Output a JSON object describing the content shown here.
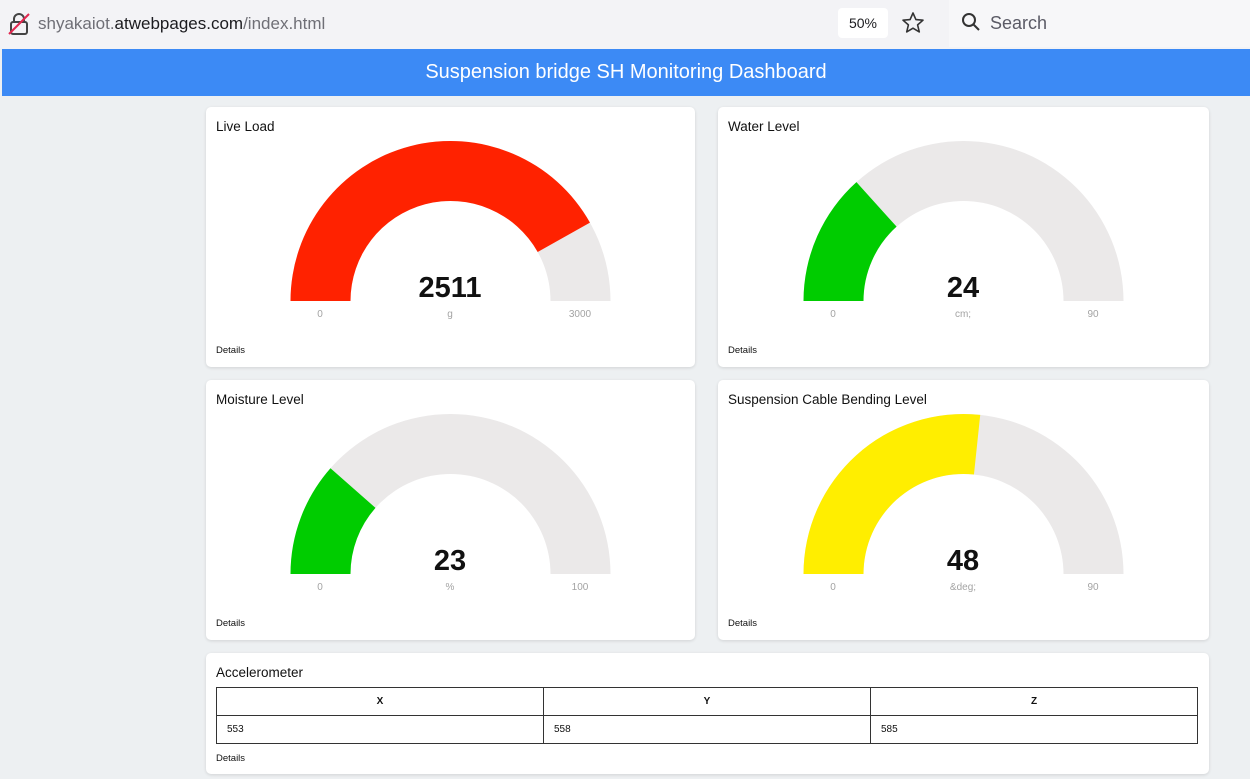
{
  "browser": {
    "url_prefix": "shyakaiot.",
    "url_domain": "atwebpages.com",
    "url_path": "/index.html",
    "zoom": "50%",
    "search_placeholder": "Search"
  },
  "header": {
    "title": "Suspension bridge SH Monitoring Dashboard"
  },
  "gauges": [
    {
      "title": "Live Load",
      "value": 2511,
      "value_label": "2511",
      "unit": "g",
      "min": 0,
      "max": 3000,
      "min_label": "0",
      "max_label": "3000",
      "color": "#ff2200",
      "details": "Details"
    },
    {
      "title": "Water Level",
      "value": 24,
      "value_label": "24",
      "unit": "cm;",
      "min": 0,
      "max": 90,
      "min_label": "0",
      "max_label": "90",
      "color": "#00cc00",
      "details": "Details"
    },
    {
      "title": "Moisture Level",
      "value": 23,
      "value_label": "23",
      "unit": "%",
      "min": 0,
      "max": 100,
      "min_label": "0",
      "max_label": "100",
      "color": "#00cc00",
      "details": "Details"
    },
    {
      "title": "Suspension Cable Bending Level",
      "value": 48,
      "value_label": "48",
      "unit": "&deg;",
      "min": 0,
      "max": 90,
      "min_label": "0",
      "max_label": "90",
      "color": "#ffee00",
      "details": "Details"
    }
  ],
  "gauge_track_color": "#ebe9e9",
  "accelerometer": {
    "title": "Accelerometer",
    "headers": [
      "X",
      "Y",
      "Z"
    ],
    "values": [
      "553",
      "558",
      "585"
    ],
    "details": "Details"
  }
}
